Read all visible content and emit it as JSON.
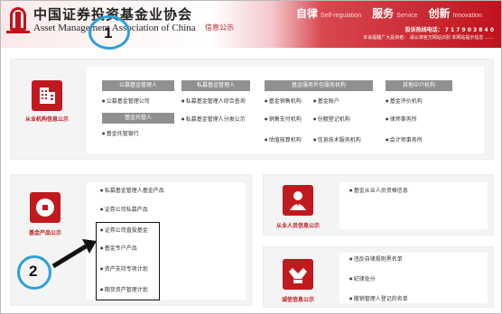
{
  "header": {
    "brand_cn": "中国证券投资基金业协会",
    "brand_en": "Asset Management Association of China",
    "brand_sub": "信息公示",
    "slogans": [
      {
        "cn": "自律",
        "en": "Self-regulation"
      },
      {
        "cn": "服务",
        "en": "Service"
      },
      {
        "cn": "创新",
        "en": "Innovation"
      }
    ],
    "hotline": "投诉热线电话：  7 1 7 9 0 3 8 4 0",
    "notice": "本会提醒广大投资者：  请认准官方网站识别  本网站提示信息 ……"
  },
  "institution": {
    "label": "从业机构信息公示",
    "groups": [
      {
        "title": "公募基金管理人",
        "items": [
          "公募基金管理公司"
        ]
      },
      {
        "title": "私募基金管理人",
        "items": [
          "私募基金管理人综合查询",
          "私募基金管理人分类公示"
        ]
      },
      {
        "title": "基金服务外包服务机构",
        "items": [
          "基金销售机构",
          "基金账户",
          "销售支付机构",
          "份额登记机构",
          "估值核算机构",
          "信息技术服务机构"
        ]
      },
      {
        "title": "其他中介机构",
        "items": [
          "基金评价机构",
          "律师事务所",
          "会计师事务所"
        ]
      },
      {
        "title": "基金托管人",
        "items": [
          "基金托管银行"
        ]
      }
    ]
  },
  "product": {
    "label": "基金产品公示",
    "items": [
      "私募基金管理人基金产品",
      "证券公司私募产品",
      "证券公司直投基金",
      "基金专户产品",
      "资产支持专项计划",
      "期货资产管理计划"
    ]
  },
  "practitioner": {
    "label": "从业人员信息公示",
    "items": [
      "基金从业人员资格信息"
    ]
  },
  "integrity": {
    "label": "诚信信息公示",
    "items": [
      "违反自律规则黑名单",
      "纪律处分",
      "撤销管理人登记的名单"
    ]
  },
  "annotations": [
    "1",
    "2"
  ],
  "colors": {
    "brand_red": "#c01a1f",
    "highlight_blue": "#2aa0d8"
  }
}
